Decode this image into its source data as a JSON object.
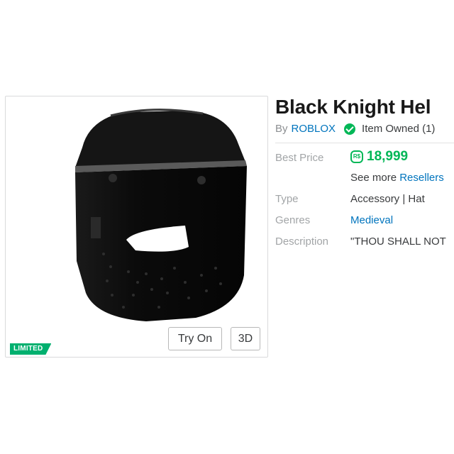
{
  "item": {
    "title": "Black Knight Hel",
    "by_label": "By",
    "creator": "ROBLOX",
    "owned_text": "Item Owned (1)",
    "limited_badge": "LIMITED"
  },
  "buttons": {
    "try_on": "Try On",
    "view_3d": "3D"
  },
  "details": {
    "best_price_label": "Best Price",
    "currency_symbol": "R$",
    "best_price": "18,999",
    "see_more_prefix": "See more",
    "resellers_link": "Resellers",
    "type_label": "Type",
    "type_value": "Accessory | Hat",
    "genres_label": "Genres",
    "genres_value": "Medieval",
    "description_label": "Description",
    "description_value": "\"THOU SHALL NOT"
  },
  "colors": {
    "accent_green": "#02b757",
    "link_blue": "#0074bd",
    "limited_green": "#00b06f"
  },
  "icons": {
    "owned": "checkmark-circle-icon",
    "currency": "robux-icon"
  }
}
